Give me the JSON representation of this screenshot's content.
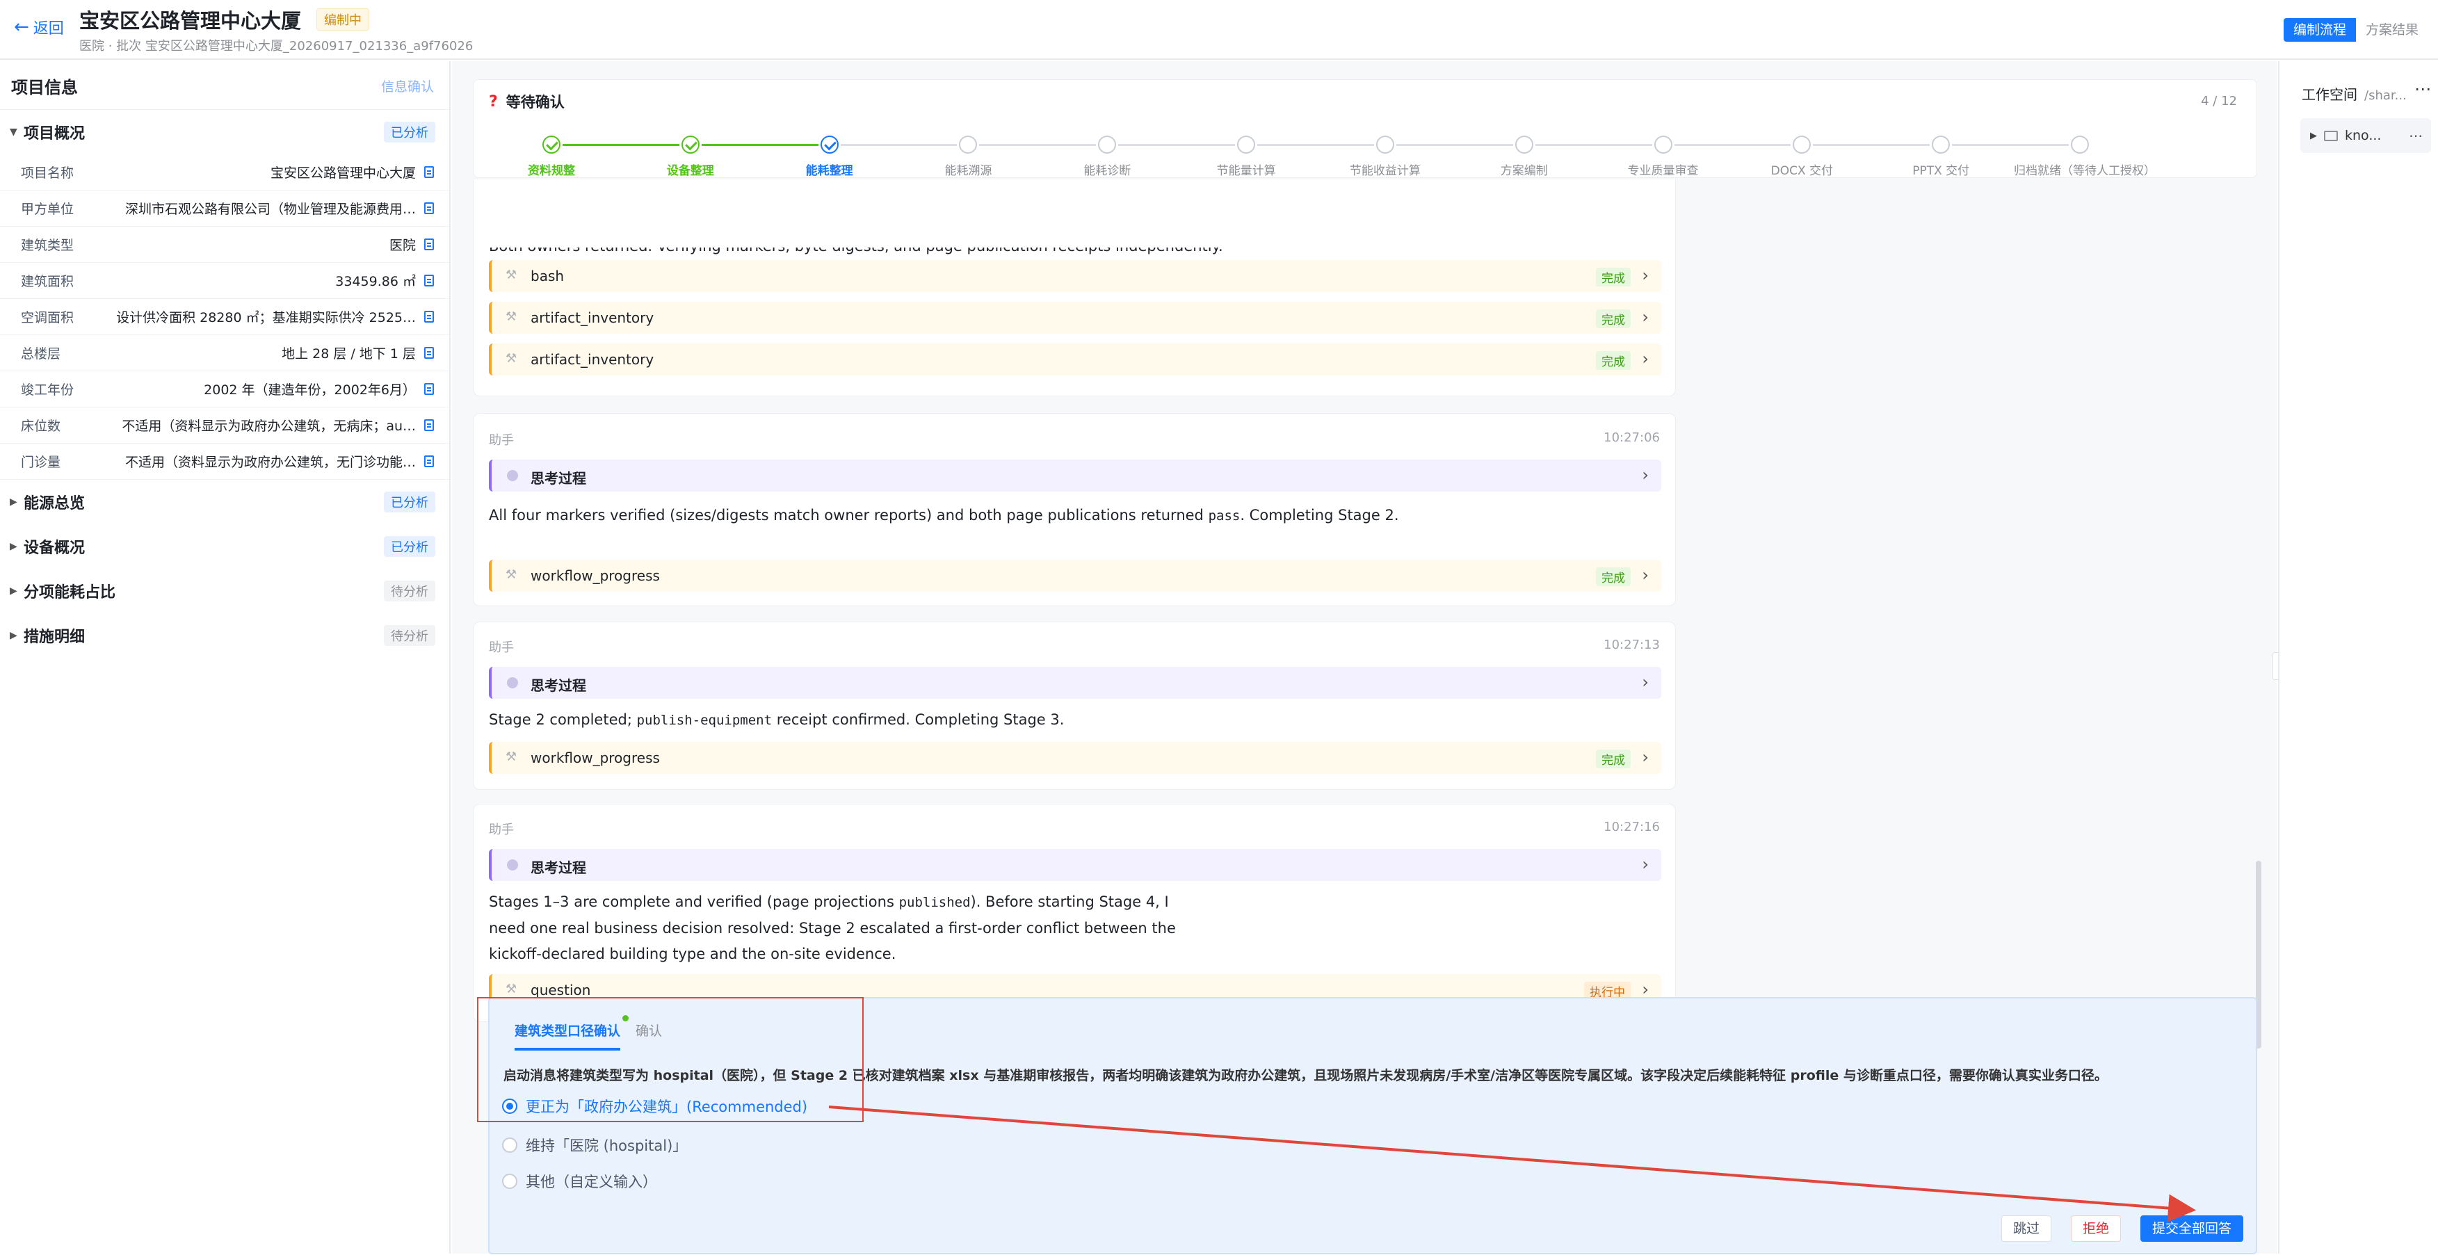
{
  "header": {
    "back_label": "返回",
    "title": "宝安区公路管理中心大厦",
    "status": "编制中",
    "subtitle": "医院 · 批次 宝安区公路管理中心大厦_20260917_021336_a9f76026",
    "view_tabs": [
      "编制流程",
      "方案结果"
    ]
  },
  "left": {
    "title": "项目信息",
    "confirm_link": "信息确认",
    "sections": [
      {
        "label": "项目概况",
        "status": "已分析",
        "expanded": true
      },
      {
        "label": "能源总览",
        "status": "已分析"
      },
      {
        "label": "设备概况",
        "status": "已分析"
      },
      {
        "label": "分项能耗占比",
        "status": "待分析"
      },
      {
        "label": "措施明细",
        "status": "待分析"
      }
    ],
    "fields": [
      {
        "key": "项目名称",
        "value": "宝安区公路管理中心大厦"
      },
      {
        "key": "甲方单位",
        "value": "深圳市石观公路有限公司（物业管理及能源费用…"
      },
      {
        "key": "建筑类型",
        "value": "医院"
      },
      {
        "key": "建筑面积",
        "value": "33459.86 ㎡"
      },
      {
        "key": "空调面积",
        "value": "设计供冷面积 28280 ㎡；基准期实际供冷 2525…"
      },
      {
        "key": "总楼层",
        "value": "地上 28 层 / 地下 1 层"
      },
      {
        "key": "竣工年份",
        "value": "2002 年（建造年份，2002年6月）"
      },
      {
        "key": "床位数",
        "value": "不适用（资料显示为政府办公建筑，无病床；au…"
      },
      {
        "key": "门诊量",
        "value": "不适用（资料显示为政府办公建筑，无门诊功能…"
      }
    ]
  },
  "progress": {
    "title": "等待确认",
    "count": "4 / 12",
    "steps": [
      {
        "name": "资料规整",
        "state": "done"
      },
      {
        "name": "设备整理",
        "state": "done"
      },
      {
        "name": "能耗整理",
        "state": "current"
      },
      {
        "name": "能耗溯源",
        "state": "todo"
      },
      {
        "name": "能耗诊断",
        "state": "todo"
      },
      {
        "name": "节能量计算",
        "state": "todo"
      },
      {
        "name": "节能收益计算",
        "state": "todo"
      },
      {
        "name": "方案编制",
        "state": "todo"
      },
      {
        "name": "专业质量审查",
        "state": "todo"
      },
      {
        "name": "DOCX 交付",
        "state": "todo"
      },
      {
        "name": "PPTX 交付",
        "state": "todo"
      },
      {
        "name": "归档就绪（等待人工授权）",
        "state": "todo"
      }
    ]
  },
  "messages": {
    "cutoff_text": "Both owners returned. Verifying markers, byte digests, and page publication receipts independently.",
    "card1_tools": [
      {
        "name": "bash",
        "status": "完成"
      },
      {
        "name": "artifact_inventory",
        "status": "完成"
      },
      {
        "name": "artifact_inventory",
        "status": "完成"
      }
    ],
    "card2": {
      "role": "助手",
      "time": "10:27:06",
      "think": "思考过程",
      "text_a": "All four markers verified (sizes/digests match owner reports) and both page publications returned ",
      "code": "pass",
      "text_b": ". Completing Stage 2.",
      "tool": "workflow_progress",
      "tool_status": "完成"
    },
    "card3": {
      "role": "助手",
      "time": "10:27:13",
      "think": "思考过程",
      "text_a": "Stage 2 completed; ",
      "code": "publish-equipment",
      "text_b": " receipt confirmed. Completing Stage 3.",
      "tool": "workflow_progress",
      "tool_status": "完成"
    },
    "card4": {
      "role": "助手",
      "time": "10:27:16",
      "think": "思考过程",
      "text_a": "Stages 1–3 are complete and verified (page projections ",
      "code": "published",
      "text_b": "). Before starting Stage 4, I need one real business decision resolved: Stage 2 escalated a first-order conflict between the kickoff-declared building type and the on-site evidence.",
      "tool": "question",
      "tool_status": "执行中"
    }
  },
  "question": {
    "tabs": [
      "建筑类型口径确认",
      "确认"
    ],
    "description": "启动消息将建筑类型写为 hospital（医院），但 Stage 2 已核对建筑档案 xlsx 与基准期审核报告，两者均明确该建筑为政府办公建筑，且现场照片未发现病房/手术室/洁净区等医院专属区域。该字段决定后续能耗特征 profile 与诊断重点口径，需要你确认真实业务口径。",
    "options": [
      {
        "label": "更正为「政府办公建筑」(Recommended)",
        "selected": true
      },
      {
        "label": "维持「医院 (hospital)」",
        "selected": false
      },
      {
        "label": "其他（自定义输入）",
        "selected": false
      }
    ],
    "actions": {
      "skip": "跳过",
      "reject": "拒绝",
      "submit": "提交全部回答"
    }
  },
  "right": {
    "title": "工作空间",
    "path": "/shar...",
    "tree_item": "kno..."
  },
  "colors": {
    "accent": "#1677ff",
    "success": "#52c41a",
    "warning": "#f5a623",
    "annotation": "#e0463a"
  }
}
